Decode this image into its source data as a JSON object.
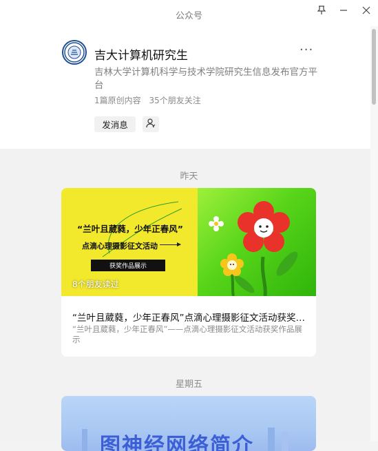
{
  "window": {
    "title": "公众号",
    "pin_icon": "pin-icon",
    "minimize_icon": "minimize-icon",
    "close_icon": "close-icon"
  },
  "profile": {
    "name": "吉大计算机研究生",
    "more": "···",
    "description": "吉林大学计算机科学与技术学院研究生信息发布官方平台",
    "original_count": "1篇原创内容",
    "friends_following": "35个朋友关注",
    "send_message": "发消息",
    "brand_color": "#1f4f93"
  },
  "feed": {
    "groups": [
      {
        "date": "昨天",
        "article": {
          "cover_title": "“兰叶且葳蕤，少年正春风”",
          "cover_subtitle": "点滴心理摄影征文活动",
          "cover_badge": "获奖作品展示",
          "friends_read": "8个朋友读过",
          "title": "“兰叶且葳蕤，少年正春风”点滴心理摄影征文活动获奖作品展示",
          "digest": "“兰叶且葳蕤，少年正春风”——点滴心理摄影征文活动获奖作品展示"
        }
      },
      {
        "date": "星期五",
        "article": {
          "cover_title": "图神经网络简介"
        }
      }
    ]
  }
}
